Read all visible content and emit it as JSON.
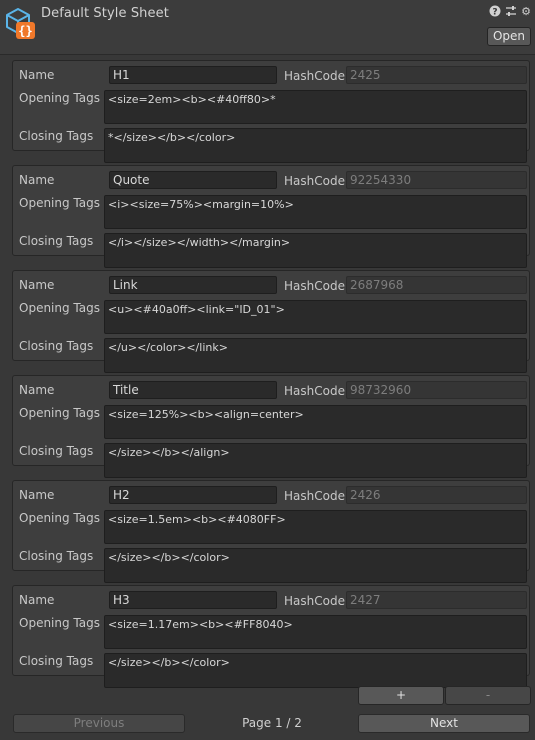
{
  "header": {
    "title": "Default Style Sheet",
    "icon": "style-sheet-asset-icon",
    "help_icon": "?",
    "settings_icon": "⚙",
    "open_label": "Open"
  },
  "labels": {
    "name": "Name",
    "hashcode": "HashCode",
    "opening": "Opening Tags",
    "closing": "Closing Tags"
  },
  "styles": [
    {
      "name": "H1",
      "hashcode": "2425",
      "opening": "<size=2em><b><#40ff80>*",
      "closing": "*</size></b></color>"
    },
    {
      "name": "Quote",
      "hashcode": "92254330",
      "opening": "<i><size=75%><margin=10%>",
      "closing": "</i></size></width></margin>"
    },
    {
      "name": "Link",
      "hashcode": "2687968",
      "opening": "<u><#40a0ff><link=\"ID_01\">",
      "closing": "</u></color></link>"
    },
    {
      "name": "Title",
      "hashcode": "98732960",
      "opening": "<size=125%><b><align=center>",
      "closing": "</size></b></align>"
    },
    {
      "name": "H2",
      "hashcode": "2426",
      "opening": "<size=1.5em><b><#4080FF>",
      "closing": "</size></b></color>"
    },
    {
      "name": "H3",
      "hashcode": "2427",
      "opening": "<size=1.17em><b><#FF8040>",
      "closing": "</size></b></color>"
    }
  ],
  "controls": {
    "add_label": "+",
    "remove_label": "-",
    "previous_label": "Previous",
    "page_label": "Page 1 / 2",
    "next_label": "Next"
  },
  "colors": {
    "background": "#383838",
    "panel": "#3e3e3e",
    "field": "#2a2a2a",
    "icon_blue": "#5ab4e8",
    "icon_orange": "#f0782a"
  }
}
